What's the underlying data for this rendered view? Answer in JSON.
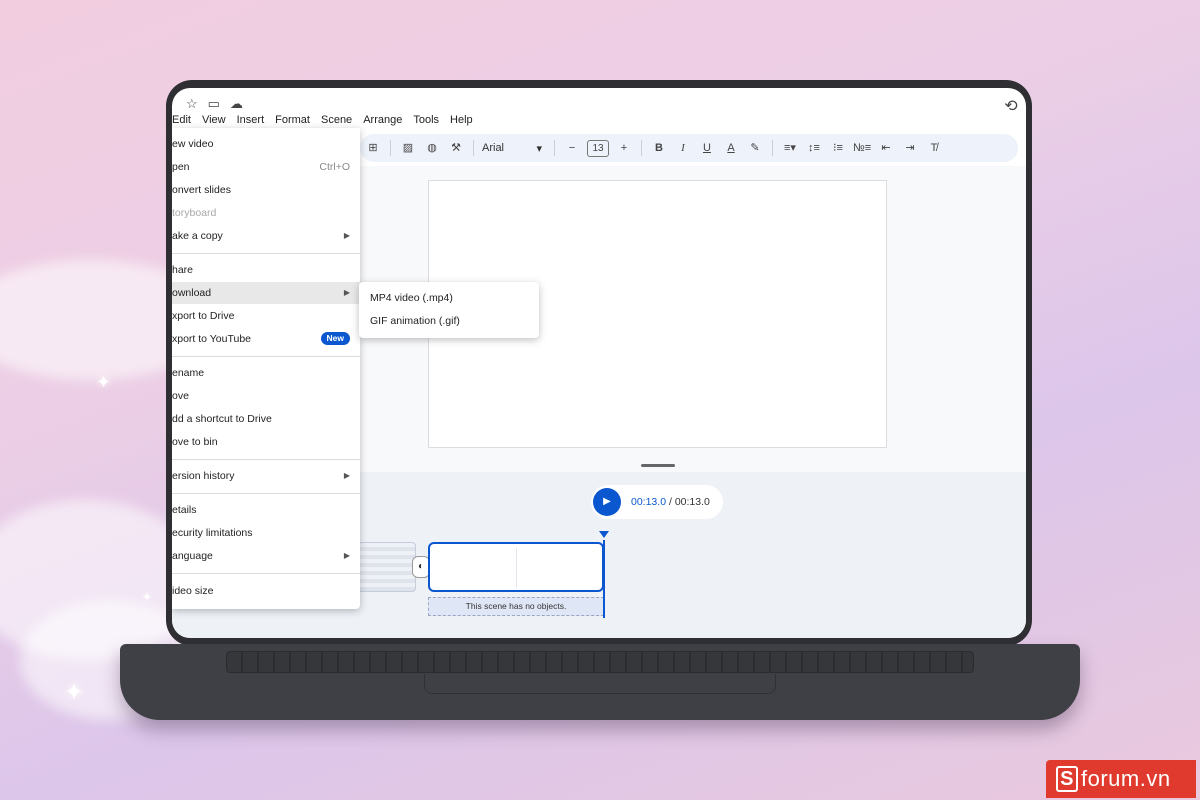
{
  "menubar": {
    "items": [
      "Edit",
      "View",
      "Insert",
      "Format",
      "Scene",
      "Arrange",
      "Tools",
      "Help"
    ]
  },
  "toolbar": {
    "font": "Arial",
    "font_size": "13"
  },
  "file_menu": {
    "items": [
      {
        "label": "ew video"
      },
      {
        "label": "pen",
        "shortcut": "Ctrl+O"
      },
      {
        "label": "onvert slides"
      },
      {
        "label": "toryboard",
        "disabled": true
      },
      {
        "label": "ake a copy",
        "submenu": true
      },
      {
        "label": "hare"
      },
      {
        "label": "ownload",
        "submenu": true,
        "active": true
      },
      {
        "label": "xport to Drive"
      },
      {
        "label": "xport to YouTube",
        "badge": "New"
      },
      {
        "label": "ename"
      },
      {
        "label": "ove"
      },
      {
        "label": "dd a shortcut to Drive"
      },
      {
        "label": "ove to bin"
      },
      {
        "label": "ersion history",
        "submenu": true
      },
      {
        "label": "etails"
      },
      {
        "label": "ecurity limitations"
      },
      {
        "label": "anguage",
        "submenu": true
      },
      {
        "label": "ideo size"
      }
    ]
  },
  "download_submenu": {
    "items": [
      "MP4 video (.mp4)",
      "GIF animation (.gif)"
    ]
  },
  "player": {
    "current_time": "00:13.0",
    "separator": " / ",
    "total_time": "00:13.0"
  },
  "timeline": {
    "scene_note": "This scene has no objects."
  },
  "watermark": {
    "logo_letter": "S",
    "text": "forum.vn"
  },
  "colors": {
    "accent": "#0b57d0",
    "watermark_bg": "#e03a2e"
  }
}
